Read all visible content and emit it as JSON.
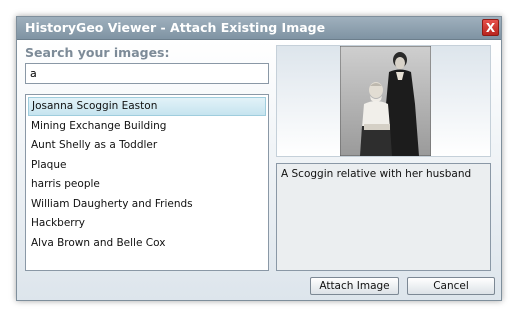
{
  "window": {
    "title": "HistoryGeo Viewer - Attach Existing Image",
    "close_label": "X"
  },
  "search": {
    "label": "Search your images:",
    "value": "a"
  },
  "images": {
    "items": [
      "Josanna Scoggin Easton",
      "Mining Exchange Building",
      "Aunt Shelly as a Toddler",
      "Plaque",
      "harris people",
      "William Daugherty and Friends",
      "Hackberry",
      "Alva Brown and Belle Cox"
    ],
    "selected_index": 0
  },
  "preview": {
    "description": "A Scoggin relative with her husband"
  },
  "buttons": {
    "attach": "Attach Image",
    "cancel": "Cancel"
  },
  "colors": {
    "titlebar": "#8fa1b0",
    "close": "#d43a33",
    "selection": "#cde8f2"
  }
}
